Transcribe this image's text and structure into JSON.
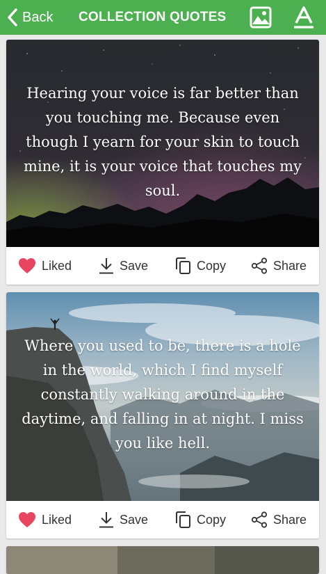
{
  "header": {
    "back_label": "Back",
    "title": "COLLECTION QUOTES",
    "bg_color": "#4caf50"
  },
  "cards": [
    {
      "quote": "Hearing your voice is far better than you touching me. Because even though I yearn for your skin to touch mine, it is your voice that touches my soul.",
      "actions": {
        "like": "Liked",
        "save": "Save",
        "copy": "Copy",
        "share": "Share"
      }
    },
    {
      "quote": "Where you used to be, there is a hole in the world, which I find myself constantly walking around in the daytime, and falling in at night. I miss you like hell.",
      "actions": {
        "like": "Liked",
        "save": "Save",
        "copy": "Copy",
        "share": "Share"
      }
    }
  ],
  "colors": {
    "like": "#e94560"
  }
}
